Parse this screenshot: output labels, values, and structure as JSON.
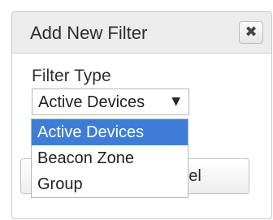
{
  "dialog": {
    "title": "Add New Filter",
    "close_icon": "close-icon"
  },
  "filter_type": {
    "label": "Filter Type",
    "selected_value": "Active Devices",
    "options": [
      "Active Devices",
      "Beacon Zone",
      "Group"
    ],
    "highlighted_index": 0
  },
  "footer": {
    "cancel_label_visible": "ancel"
  },
  "colors": {
    "accent_highlight": "#3d7dd8",
    "header_bg": "#ececec"
  }
}
